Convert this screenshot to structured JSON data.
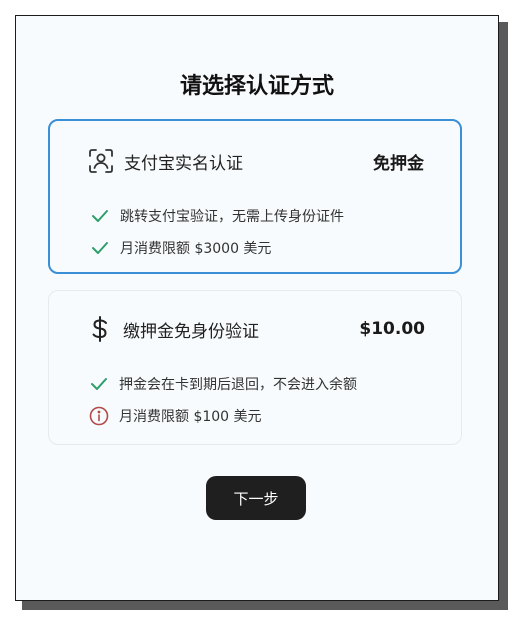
{
  "dialog": {
    "title": "请选择认证方式",
    "next_label": "下一步"
  },
  "options": [
    {
      "icon": "face-scan-icon",
      "title": "支付宝实名认证",
      "price": "免押金",
      "selected": true,
      "features": [
        {
          "icon": "check-icon",
          "text": "跳转支付宝验证，无需上传身份证件"
        },
        {
          "icon": "check-icon",
          "text": "月消费限额 $3000 美元"
        }
      ]
    },
    {
      "icon": "dollar-icon",
      "title": "缴押金免身份验证",
      "price": "$10.00",
      "selected": false,
      "features": [
        {
          "icon": "check-icon",
          "text": "押金会在卡到期后退回，不会进入余额"
        },
        {
          "icon": "info-icon",
          "text": "月消费限额 $100 美元"
        }
      ]
    }
  ],
  "colors": {
    "selected_border": "#3a8fd6",
    "check": "#2e9e6b",
    "info": "#b24a4a",
    "button": "#1f1f1f"
  }
}
